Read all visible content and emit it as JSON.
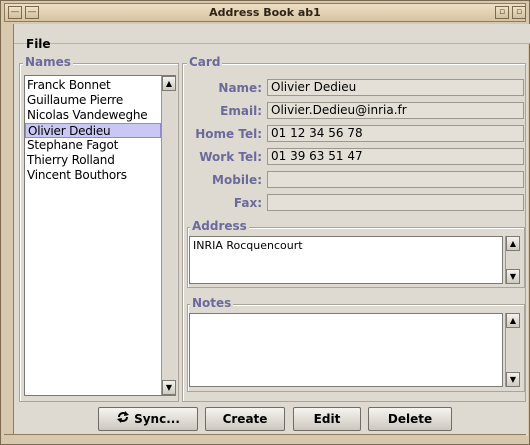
{
  "window": {
    "title": "Address Book ab1"
  },
  "menu": {
    "file": "File"
  },
  "names": {
    "legend": "Names",
    "items": [
      {
        "label": "Franck Bonnet"
      },
      {
        "label": "Guillaume Pierre"
      },
      {
        "label": "Nicolas Vandeweghe"
      },
      {
        "label": "Olivier Dedieu",
        "selected": true
      },
      {
        "label": "Stephane Fagot"
      },
      {
        "label": "Thierry Rolland"
      },
      {
        "label": "Vincent Bouthors"
      }
    ]
  },
  "card": {
    "legend": "Card",
    "fields": [
      {
        "label": "Name:",
        "value": "Olivier Dedieu"
      },
      {
        "label": "Email:",
        "value": "Olivier.Dedieu@inria.fr"
      },
      {
        "label": "Home Tel:",
        "value": "01 12 34 56 78"
      },
      {
        "label": "Work Tel:",
        "value": "01 39 63 51 47"
      },
      {
        "label": "Mobile:",
        "value": ""
      },
      {
        "label": "Fax:",
        "value": ""
      }
    ],
    "address": {
      "legend": "Address",
      "value": "INRIA Rocquencourt"
    },
    "notes": {
      "legend": "Notes",
      "value": ""
    }
  },
  "buttons": {
    "sync": "Sync...",
    "create": "Create",
    "edit": "Edit",
    "delete": "Delete"
  },
  "icons": {
    "sync": "sync-icon",
    "scroll_up": "arrow-up-icon",
    "scroll_down": "arrow-down-icon"
  }
}
